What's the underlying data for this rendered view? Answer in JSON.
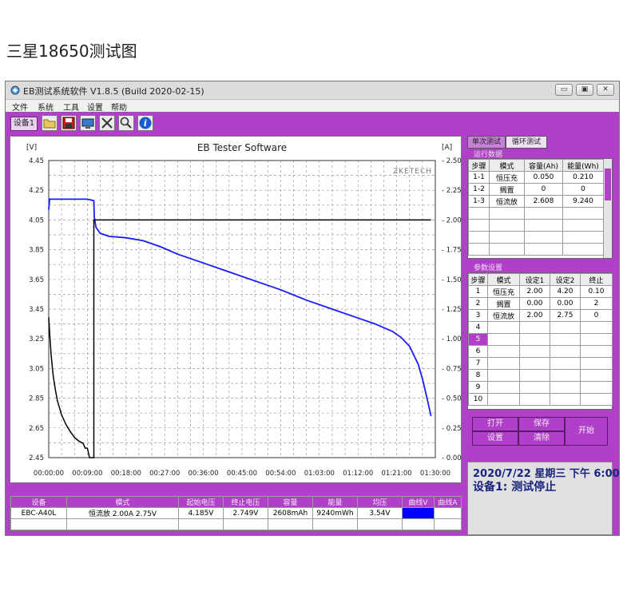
{
  "page_heading": "三星18650测试图",
  "window": {
    "title": "EB测试系统软件 V1.8.5 (Build 2020-02-15)",
    "controls": {
      "minimize": "▭",
      "restore": "▣",
      "close": "✕"
    }
  },
  "menu": [
    "文件",
    "系统",
    "工具",
    "设置",
    "帮助"
  ],
  "toolbar": {
    "device_tab": "设备1",
    "icons": [
      "folder-icon",
      "save-icon",
      "monitor-icon",
      "tools-icon",
      "search-icon",
      "info-icon"
    ]
  },
  "chart": {
    "title": "EB Tester Software",
    "left_unit": "[V]",
    "right_unit": "[A]",
    "watermark": "ZKETECH",
    "left_ticks": [
      "4.45",
      "4.25",
      "4.05",
      "3.85",
      "3.65",
      "3.45",
      "3.25",
      "3.05",
      "2.85",
      "2.65",
      "2.45"
    ],
    "right_ticks": [
      "2.50",
      "2.25",
      "2.00",
      "1.75",
      "1.50",
      "1.25",
      "1.00",
      "0.75",
      "0.50",
      "0.25",
      "0.00"
    ],
    "x_ticks": [
      "00:00:00",
      "00:09:00",
      "00:18:00",
      "00:27:00",
      "00:36:00",
      "00:45:00",
      "00:54:00",
      "01:03:00",
      "01:12:00",
      "01:21:00",
      "01:30:00"
    ]
  },
  "chart_data": {
    "type": "line",
    "title": "EB Tester Software",
    "xlabel": "",
    "ylabel": "[V]",
    "ylabel_right": "[A]",
    "x_unit": "minutes",
    "xlim": [
      0,
      90
    ],
    "ylim": [
      2.45,
      4.45
    ],
    "ylim_right": [
      0,
      2.5
    ],
    "grid": true,
    "series": [
      {
        "axis": "left",
        "x": [
          0,
          0.2,
          1,
          3,
          5,
          7,
          9,
          10.5,
          10.6,
          11,
          12,
          14,
          18,
          22,
          26,
          30,
          36,
          42,
          48,
          54,
          60,
          66,
          72,
          76,
          80,
          82,
          84,
          86,
          87,
          88,
          89
        ],
        "y": [
          4.12,
          4.19,
          4.19,
          4.19,
          4.19,
          4.19,
          4.19,
          4.18,
          4.07,
          4.0,
          3.96,
          3.94,
          3.93,
          3.91,
          3.87,
          3.82,
          3.76,
          3.7,
          3.64,
          3.58,
          3.51,
          3.45,
          3.39,
          3.35,
          3.3,
          3.26,
          3.2,
          3.08,
          2.98,
          2.86,
          2.73
        ]
      },
      {
        "axis": "right",
        "x": [
          0,
          0.3,
          0.6,
          1,
          1.5,
          2,
          3,
          4,
          5,
          6,
          7,
          8,
          8.5,
          9,
          9.5,
          10.5,
          10.5,
          10.6,
          89
        ],
        "y": [
          1.18,
          1.0,
          0.85,
          0.7,
          0.58,
          0.48,
          0.36,
          0.28,
          0.22,
          0.17,
          0.14,
          0.12,
          0.08,
          0.08,
          0.0,
          0.0,
          2.0,
          2.0,
          2.0
        ]
      }
    ]
  },
  "right_tabs": {
    "single": "单次测试",
    "cycle": "循环测试"
  },
  "run_data": {
    "title": "运行数据",
    "headers": [
      "步骤",
      "模式",
      "容量(Ah)",
      "能量(Wh)"
    ],
    "rows": [
      [
        "1-1",
        "恒压充",
        "0.050",
        "0.210"
      ],
      [
        "1-2",
        "搁置",
        "0",
        "0"
      ],
      [
        "1-3",
        "恒流放",
        "2.608",
        "9.240"
      ]
    ]
  },
  "params": {
    "title": "参数设置",
    "headers": [
      "步骤",
      "模式",
      "设定1",
      "设定2",
      "终止"
    ],
    "rows": [
      [
        "1",
        "恒压充",
        "2.00",
        "4.20",
        "0.10"
      ],
      [
        "2",
        "搁置",
        "0.00",
        "0.00",
        "2"
      ],
      [
        "3",
        "恒流放",
        "2.00",
        "2.75",
        "0"
      ],
      [
        "4",
        "",
        "",
        "",
        ""
      ],
      [
        "5",
        "",
        "",
        "",
        ""
      ],
      [
        "6",
        "",
        "",
        "",
        ""
      ],
      [
        "7",
        "",
        "",
        "",
        ""
      ],
      [
        "8",
        "",
        "",
        "",
        ""
      ],
      [
        "9",
        "",
        "",
        "",
        ""
      ],
      [
        "10",
        "",
        "",
        "",
        ""
      ]
    ]
  },
  "buttons": {
    "open": "打开",
    "save": "保存",
    "settings": "设置",
    "clear": "清除",
    "start": "开始"
  },
  "status": {
    "datetime": "2020/7/22 星期三 下午 6:00",
    "state": "设备1: 测试停止"
  },
  "bottom": {
    "headers": [
      "设备",
      "模式",
      "起始电压",
      "终止电压",
      "容量",
      "能量",
      "均压",
      "曲线V",
      "曲线A"
    ],
    "row": [
      "EBC-A40L",
      "恒流放  2.00A  2.75V",
      "4.185V",
      "2.749V",
      "2608mAh",
      "9240mWh",
      "3.54V",
      "",
      ""
    ],
    "curve_v_color": "#0000ff"
  },
  "colors": {
    "accent": "#b040c8",
    "voltage": "#1a1aff",
    "current": "#000000",
    "status_text": "#1a237e"
  }
}
